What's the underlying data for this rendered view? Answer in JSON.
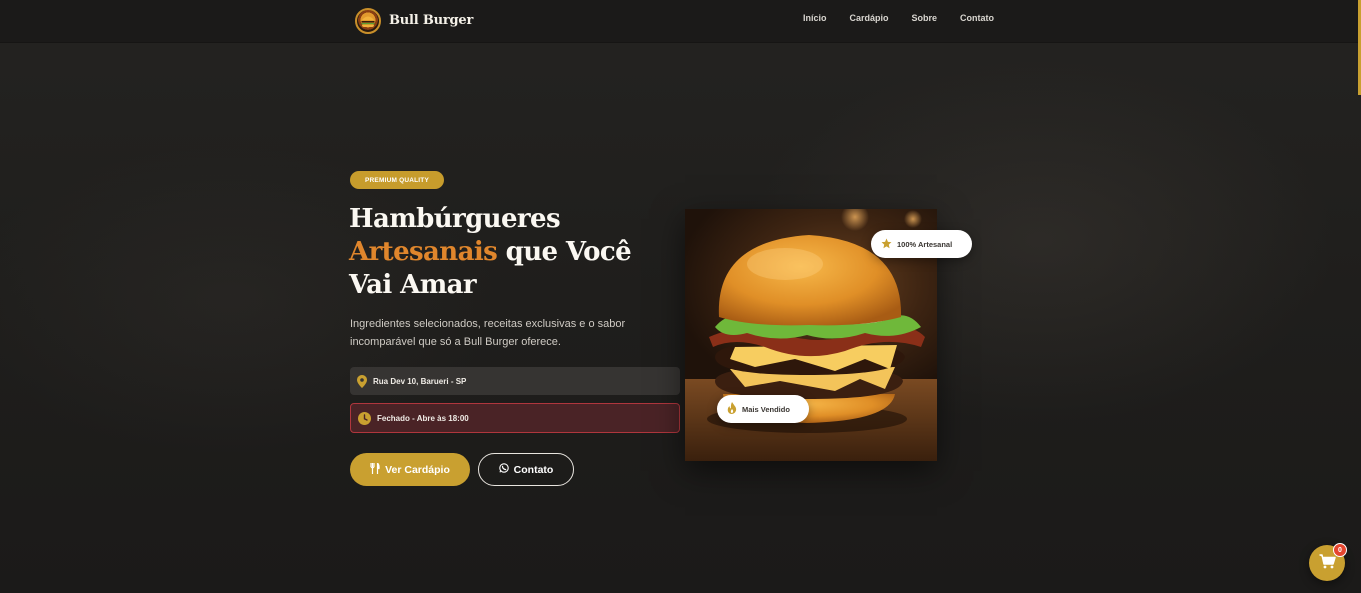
{
  "navbar": {
    "brand_name": "Bull Burger",
    "links": [
      {
        "label": "Início"
      },
      {
        "label": "Cardápio"
      },
      {
        "label": "Sobre"
      },
      {
        "label": "Contato"
      }
    ]
  },
  "hero": {
    "badge": "PREMIUM QUALITY",
    "title_part1": "Hambúrgueres",
    "title_accent": "Artesanais",
    "title_part2": " que Você Vai Amar",
    "subtitle": "Ingredientes selecionados, receitas exclusivas e o sabor incomparável que só a Bull Burger oferece.",
    "address": "Rua Dev 10, Barueri - SP",
    "status": "Fechado - Abre às 18:00",
    "menu_button": "Ver Cardápio",
    "contact_button": "Contato",
    "tag_artisan": "100% Artesanal",
    "tag_best_seller": "Mais Vendido"
  },
  "cart": {
    "count": "0"
  },
  "colors": {
    "accent_gold": "#c9a030",
    "accent_orange": "#e0862c",
    "status_red": "#b0363d",
    "background": "#1e1d1c"
  },
  "icons": {
    "logo": "burger-logo-icon",
    "address": "map-pin-icon",
    "status": "clock-icon",
    "menu": "utensils-icon",
    "contact": "whatsapp-icon",
    "artisan": "star-icon",
    "best_seller": "fire-icon",
    "cart": "cart-icon"
  }
}
